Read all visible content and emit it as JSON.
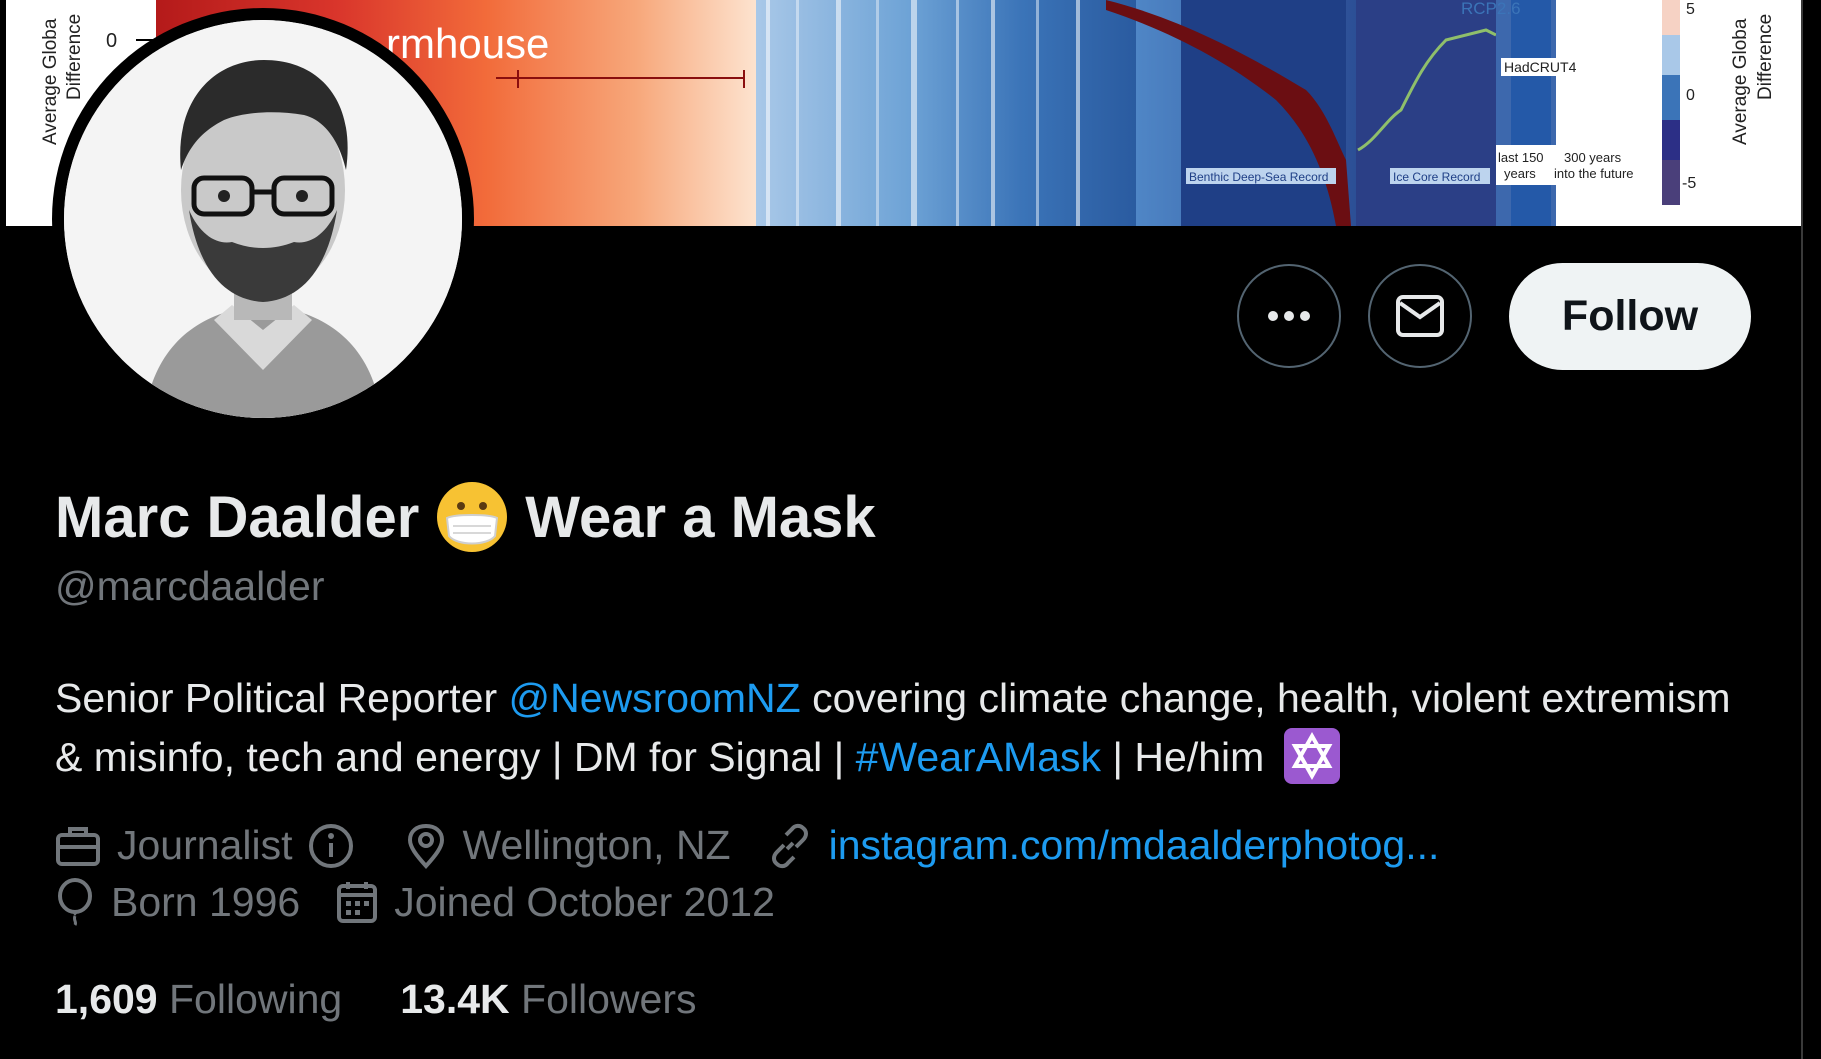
{
  "profile": {
    "name": "Marc Daalder",
    "name_suffix": "Wear a Mask",
    "handle": "@marcdaalder",
    "bio": {
      "part1": "Senior Political Reporter ",
      "mention": "@NewsroomNZ",
      "part2": " covering climate change, health, violent extremism & misinfo, tech and energy | DM for Signal | ",
      "hashtag": "#WearAMask",
      "part3": " | He/him "
    },
    "meta": {
      "category": "Journalist",
      "location": "Wellington, NZ",
      "link": "instagram.com/mdaalderphotog...",
      "born": "Born 1996",
      "joined": "Joined October 2012"
    },
    "stats": {
      "following_count": "1,609",
      "following_label": "Following",
      "followers_count": "13.4K",
      "followers_label": "Followers"
    }
  },
  "actions": {
    "follow_label": "Follow"
  },
  "banner": {
    "texts": {
      "farmhouse": "rmhouse",
      "rcp": "RCP2.6",
      "hadcrut": "HadCRUT4",
      "last150": "last 150",
      "years": "years",
      "future1": "300 years",
      "future2": "into the future",
      "benthic": "Benthic Deep-Sea Record",
      "icecore": "Ice Core Record",
      "zero_left": "0",
      "axis_left1": "Average Globa",
      "axis_left2": "Difference",
      "axis_right1": "Average Globa",
      "axis_right2": "Difference",
      "scale_5": "5",
      "scale_0": "0",
      "scale_m5": "-5"
    }
  },
  "colors": {
    "accent": "#1d9bf0",
    "muted": "#71767b",
    "text": "#e7e9ea",
    "follow_bg": "#eff3f4"
  }
}
